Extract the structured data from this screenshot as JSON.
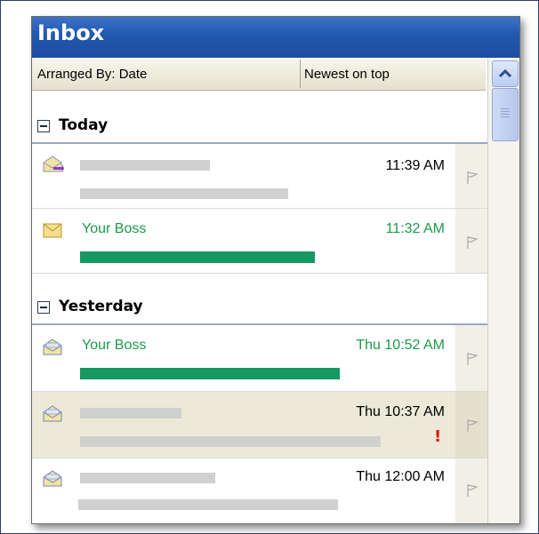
{
  "title": "Inbox",
  "arrange": {
    "by_label": "Arranged By: Date",
    "order_label": "Newest on top"
  },
  "groups": [
    {
      "title": "Today"
    },
    {
      "title": "Yesterday"
    }
  ],
  "messages": [
    {
      "sender": "",
      "time": "11:39 AM"
    },
    {
      "sender": "Your Boss",
      "time": "11:32 AM"
    },
    {
      "sender": "Your Boss",
      "time": "Thu 10:52 AM"
    },
    {
      "sender": "",
      "time": "Thu 10:37 AM",
      "important": "!"
    },
    {
      "sender": "",
      "time": "Thu 12:00 AM"
    }
  ],
  "colors": {
    "title_bar": "#2158b0",
    "boss_text": "#1d9a4a",
    "boss_bar": "#159861",
    "highlight_row": "#ece9d8",
    "important": "#e01010"
  },
  "icons": [
    "envelope-forward-icon",
    "envelope-closed-icon",
    "envelope-open-icon",
    "flag-icon",
    "collapse-icon",
    "scroll-up-icon"
  ]
}
